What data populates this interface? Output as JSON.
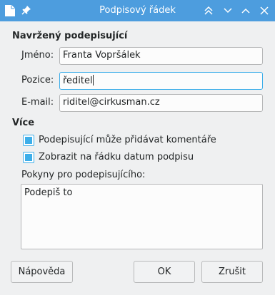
{
  "window": {
    "title": "Podpisový řádek",
    "accent_color": "#4d9dde",
    "icons": [
      "document-icon",
      "pin-icon",
      "keep-above-icon",
      "minimize-icon",
      "maximize-icon",
      "close-icon"
    ]
  },
  "signer_section": {
    "heading": "Navržený podepisující",
    "name_label": "Jméno:",
    "name_value": "Franta Vopršálek",
    "position_label": "Pozice:",
    "position_value": "ředitel",
    "email_label": "E-mail:",
    "email_value": "riditel@cirkusman.cz"
  },
  "more_section": {
    "heading": "Více",
    "allow_comments_label": "Podepisující může přidávat komentáře",
    "allow_comments_checked": true,
    "show_date_label": "Zobrazit na řádku datum podpisu",
    "show_date_checked": true,
    "instructions_label": "Pokyny pro podepisujícího:",
    "instructions_value": "Podepiš to"
  },
  "buttons": {
    "help_label": "Nápověda",
    "ok_label": "OK",
    "cancel_label": "Zrušit"
  }
}
